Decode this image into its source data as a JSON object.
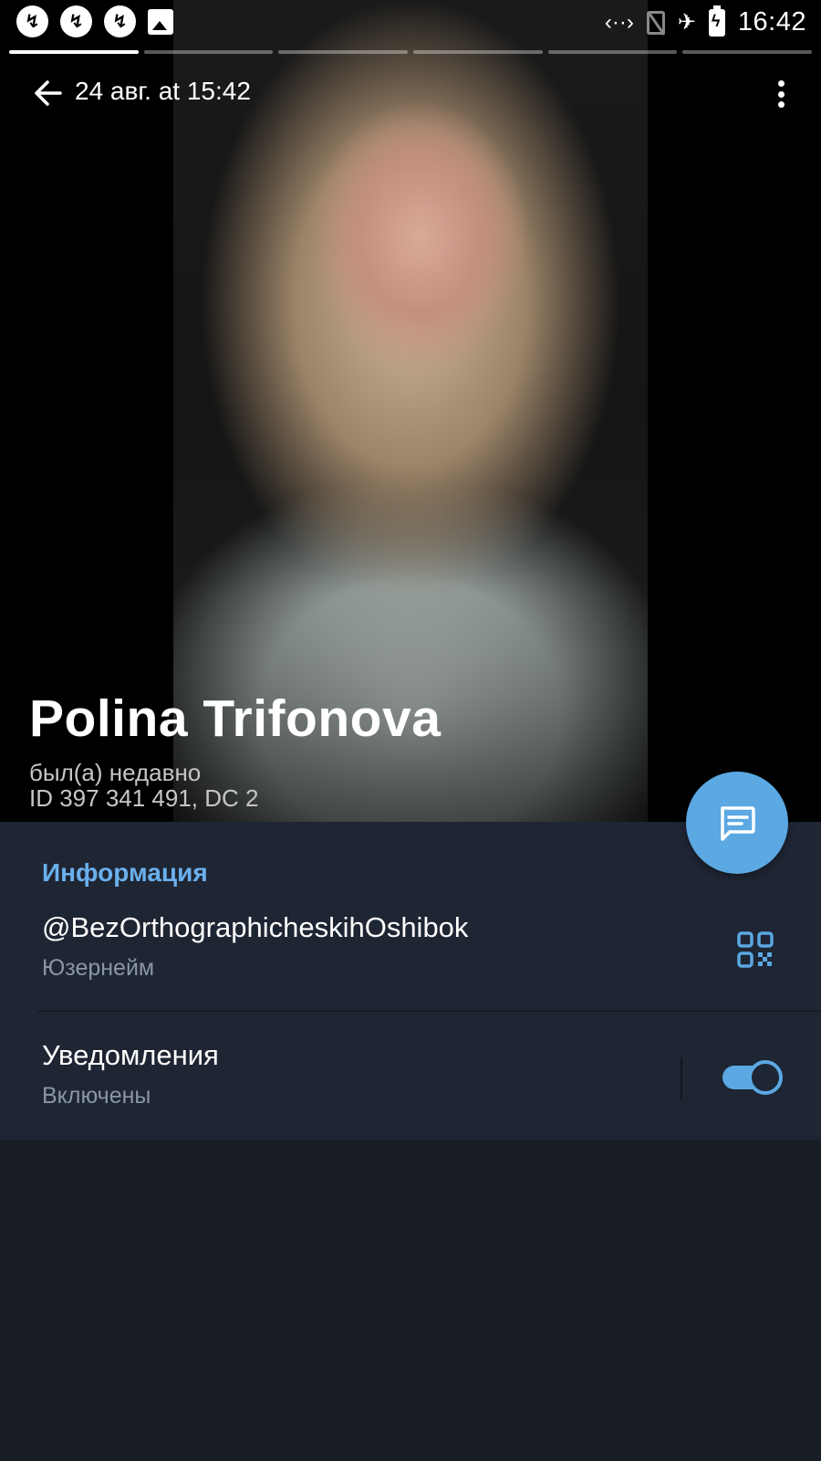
{
  "status_bar": {
    "notification_icons": [
      "app-a-icon",
      "app-a-icon",
      "app-a-icon",
      "image-icon"
    ],
    "app_glyph": "↯",
    "time": "16:42"
  },
  "stories": {
    "count": 6,
    "active_index": 0
  },
  "header": {
    "date": "24 авг. at 15:42"
  },
  "profile": {
    "name": "Polina Trifonova",
    "last_seen": "был(а) недавно",
    "id_line": "ID 397 341 491, DC 2"
  },
  "info": {
    "section_title": "Информация",
    "username": "@BezOrthographicheskihOshibok",
    "username_label": "Юзернейм",
    "notifications_label": "Уведомления",
    "notifications_status": "Включены",
    "notifications_enabled": true
  },
  "colors": {
    "accent": "#5ba8e3",
    "section_title": "#6ab0ec",
    "card_bg": "#1e2533",
    "page_bg": "#181d26"
  }
}
